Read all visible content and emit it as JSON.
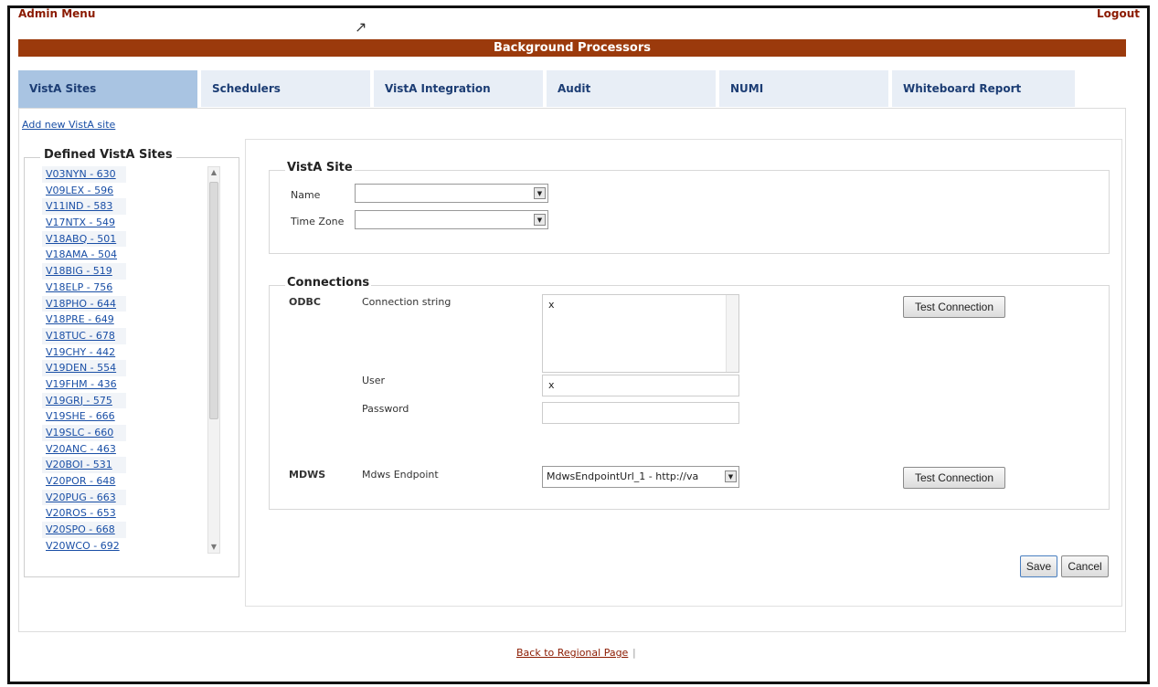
{
  "header": {
    "admin_menu": "Admin Menu",
    "logout": "Logout",
    "title": "Background Processors"
  },
  "tabs": [
    {
      "label": "VistA Sites",
      "active": true
    },
    {
      "label": "Schedulers",
      "active": false
    },
    {
      "label": "VistA Integration",
      "active": false
    },
    {
      "label": "Audit",
      "active": false
    },
    {
      "label": "NUMI",
      "active": false
    },
    {
      "label": "Whiteboard Report",
      "active": false
    }
  ],
  "sidebar": {
    "add_link": "Add new VistA site",
    "legend": "Defined VistA Sites",
    "sites": [
      "V03NYN - 630",
      "V09LEX - 596",
      "V11IND - 583",
      "V17NTX - 549",
      "V18ABQ - 501",
      "V18AMA - 504",
      "V18BIG - 519",
      "V18ELP - 756",
      "V18PHO - 644",
      "V18PRE - 649",
      "V18TUC - 678",
      "V19CHY - 442",
      "V19DEN - 554",
      "V19FHM - 436",
      "V19GRJ - 575",
      "V19SHE - 666",
      "V19SLC - 660",
      "V20ANC - 463",
      "V20BOI - 531",
      "V20POR - 648",
      "V20PUG - 663",
      "V20ROS - 653",
      "V20SPO - 668",
      "V20WCO - 692"
    ]
  },
  "vista_site": {
    "legend": "VistA Site",
    "name_label": "Name",
    "name_value": "",
    "timezone_label": "Time Zone",
    "timezone_value": ""
  },
  "connections": {
    "legend": "Connections",
    "odbc_label": "ODBC",
    "conn_string_label": "Connection string",
    "conn_string_value": "x",
    "user_label": "User",
    "user_value": "x",
    "password_label": "Password",
    "password_value": "",
    "test_connection_label": "Test Connection",
    "mdws_label": "MDWS",
    "mdws_endpoint_label": "Mdws Endpoint",
    "mdws_endpoint_value": "MdwsEndpointUrl_1 - http://va",
    "test_connection_label_2": "Test Connection"
  },
  "actions": {
    "save": "Save",
    "cancel": "Cancel"
  },
  "footer": {
    "back_link": "Back to Regional Page",
    "separator": "|"
  }
}
